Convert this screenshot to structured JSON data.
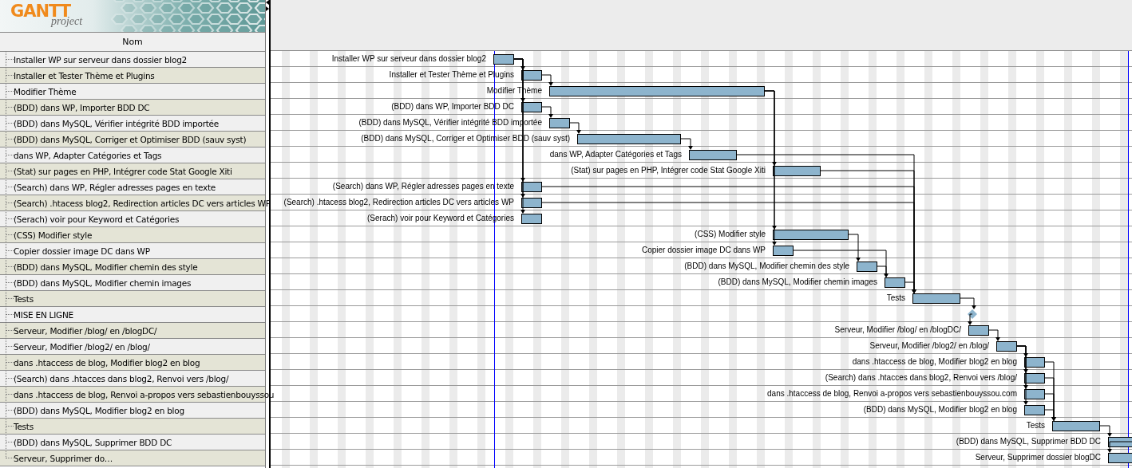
{
  "logo": {
    "wordmark": "GANTT",
    "tagline": "project"
  },
  "task_tree": {
    "column": "Nom",
    "rows": [
      {
        "name": "Installer WP sur serveur dans dossier blog2"
      },
      {
        "name": "Installer et Tester Thème  et Plugins"
      },
      {
        "name": "Modifier Thème"
      },
      {
        "name": "(BDD) dans WP, Importer BDD DC"
      },
      {
        "name": "(BDD) dans MySQL, Vérifier intégrité BDD importée"
      },
      {
        "name": "(BDD) dans MySQL, Corriger et Optimiser BDD (sauv syst)"
      },
      {
        "name": "dans WP, Adapter Catégories et Tags"
      },
      {
        "name": "(Stat) sur pages en PHP, Intégrer code Stat Google Xiti"
      },
      {
        "name": "(Search) dans WP, Régler adresses pages en texte"
      },
      {
        "name": "(Search) .htacess blog2, Redirection articles DC vers articles WP"
      },
      {
        "name": "(Serach) voir pour Keyword et Catégories"
      },
      {
        "name": "(CSS) Modifier style"
      },
      {
        "name": "Copier dossier image DC dans WP"
      },
      {
        "name": "(BDD) dans MySQL, Modifier chemin des style"
      },
      {
        "name": "(BDD) dans MySQL, Modifier chemin images"
      },
      {
        "name": "Tests"
      },
      {
        "name": "MISE EN LIGNE"
      },
      {
        "name": "Serveur, Modifier /blog/ en /blogDC/"
      },
      {
        "name": "Serveur, Modifier /blog2/ en /blog/"
      },
      {
        "name": "dans .htaccess de blog, Modifier blog2 en blog"
      },
      {
        "name": "(Search) dans .htacces dans blog2, Renvoi vers /blog/"
      },
      {
        "name": "dans .htaccess de blog, Renvoi a-propos vers sebastienbouyssou"
      },
      {
        "name": "(BDD) dans MySQL, Modifier blog2 en blog"
      },
      {
        "name": "Tests"
      },
      {
        "name": "(BDD) dans MySQL, Supprimer BDD DC"
      },
      {
        "name": "Serveur, Supprimer do…"
      }
    ]
  },
  "gantt": {
    "bars": [
      {
        "kind": "task",
        "label": "Installer WP sur serveur dans dossier blog2"
      },
      {
        "kind": "task",
        "label": "Installer et Tester Thème  et Plugins"
      },
      {
        "kind": "task",
        "label": "Modifier Thème"
      },
      {
        "kind": "task",
        "label": "(BDD) dans WP, Importer BDD DC"
      },
      {
        "kind": "task",
        "label": "(BDD) dans MySQL, Vérifier intégrité BDD importée"
      },
      {
        "kind": "task",
        "label": "(BDD) dans MySQL, Corriger et Optimiser BDD (sauv syst)"
      },
      {
        "kind": "task",
        "label": "dans WP, Adapter Catégories et Tags"
      },
      {
        "kind": "task",
        "label": "(Stat) sur pages en PHP, Intégrer code Stat Google Xiti"
      },
      {
        "kind": "task",
        "label": "(Search) dans WP, Régler adresses pages en texte"
      },
      {
        "kind": "task",
        "label": "(Search) .htacess blog2, Redirection articles DC vers articles WP"
      },
      {
        "kind": "task",
        "label": "(Serach) voir pour Keyword et Catégories"
      },
      {
        "kind": "task",
        "label": "(CSS) Modifier style"
      },
      {
        "kind": "task",
        "label": "Copier dossier image DC dans WP"
      },
      {
        "kind": "task",
        "label": "(BDD) dans MySQL, Modifier chemin des style"
      },
      {
        "kind": "task",
        "label": "(BDD) dans MySQL, Modifier chemin images"
      },
      {
        "kind": "task",
        "label": "Tests"
      },
      {
        "kind": "milestone"
      },
      {
        "kind": "task",
        "label": "Serveur, Modifier /blog/ en /blogDC/"
      },
      {
        "kind": "task",
        "label": "Serveur, Modifier /blog2/ en /blog/"
      },
      {
        "kind": "task",
        "label": "dans .htaccess de blog, Modifier blog2 en blog"
      },
      {
        "kind": "task",
        "label": "(Search) dans .htacces dans blog2, Renvoi vers /blog/"
      },
      {
        "kind": "task",
        "label": "dans .htaccess de blog, Renvoi a-propos vers sebastienbouyssou.com"
      },
      {
        "kind": "task",
        "label": "(BDD) dans MySQL, Modifier blog2 en blog"
      },
      {
        "kind": "task",
        "label": "Tests"
      },
      {
        "kind": "task",
        "label": "(BDD) dans MySQL, Supprimer BDD DC"
      },
      {
        "kind": "task",
        "label": "Serveur, Supprimer dossier blogDC"
      }
    ]
  }
}
